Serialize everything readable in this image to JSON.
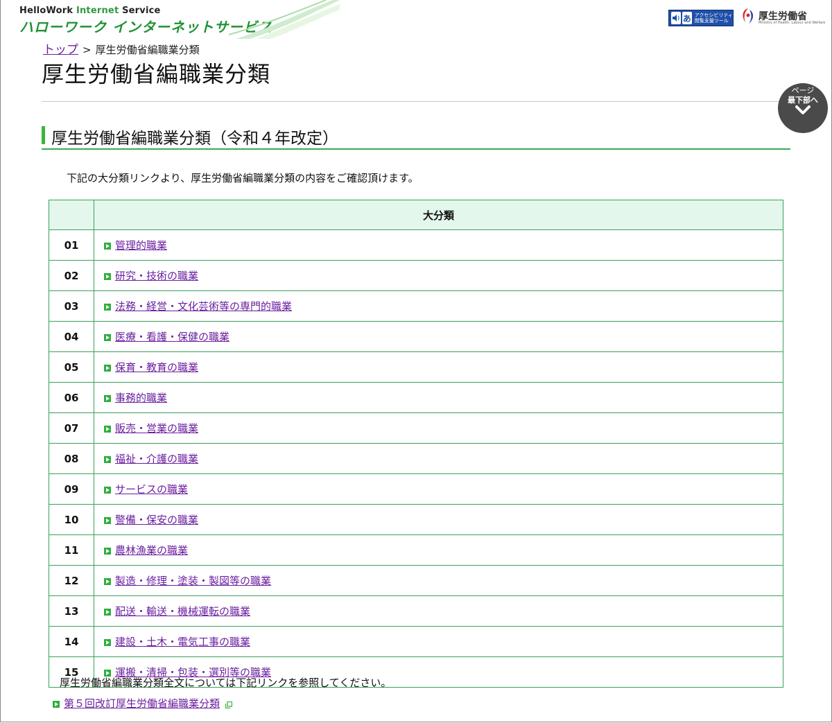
{
  "header": {
    "brand_en_pre": "HelloWork ",
    "brand_en_mid": "Internet",
    "brand_en_post": " Service",
    "brand_jp": "ハローワーク インターネットサービス",
    "accessibility_text": "アクセシビリティ\n閲覧支援ツール",
    "accessibility_icon_glyph": "あ",
    "mhlw_name": "厚生労働省",
    "mhlw_sub": "Ministry of Health, Labour and Welfare"
  },
  "breadcrumb": {
    "top_link": "トップ",
    "separator": ">",
    "current": "厚生労働省編職業分類"
  },
  "page_title": "厚生労働省編職業分類",
  "scroll_button": {
    "line1": "ページ",
    "line2": "最下部へ"
  },
  "section": {
    "title": "厚生労働省編職業分類（令和４年改定）",
    "intro": "下記の大分類リンクより、厚生労働省編職業分類の内容をご確認頂けます。"
  },
  "table": {
    "header_label": "大分類",
    "rows": [
      {
        "code": "01",
        "name": "管理的職業"
      },
      {
        "code": "02",
        "name": "研究・技術の職業"
      },
      {
        "code": "03",
        "name": "法務・経営・文化芸術等の専門的職業"
      },
      {
        "code": "04",
        "name": "医療・看護・保健の職業"
      },
      {
        "code": "05",
        "name": "保育・教育の職業"
      },
      {
        "code": "06",
        "name": "事務的職業"
      },
      {
        "code": "07",
        "name": "販売・営業の職業"
      },
      {
        "code": "08",
        "name": "福祉・介護の職業"
      },
      {
        "code": "09",
        "name": "サービスの職業"
      },
      {
        "code": "10",
        "name": "警備・保安の職業"
      },
      {
        "code": "11",
        "name": "農林漁業の職業"
      },
      {
        "code": "12",
        "name": "製造・修理・塗装・製図等の職業"
      },
      {
        "code": "13",
        "name": "配送・輸送・機械運転の職業"
      },
      {
        "code": "14",
        "name": "建設・土木・電気工事の職業"
      },
      {
        "code": "15",
        "name": "運搬・清掃・包装・選別等の職業"
      }
    ]
  },
  "footer": {
    "note": "厚生労働省編職業分類全文については下記リンクを参照してください。",
    "fulltext_link": "第５回改訂厚生労働省編職業分類"
  },
  "colors": {
    "brand_green": "#1f9133",
    "table_border": "#3a9f5a",
    "table_header_bg": "#e4f7ec",
    "link": "#6b1fa0",
    "link_icon": "#2fae3e",
    "accessibility_blue": "#1f4fa8"
  }
}
